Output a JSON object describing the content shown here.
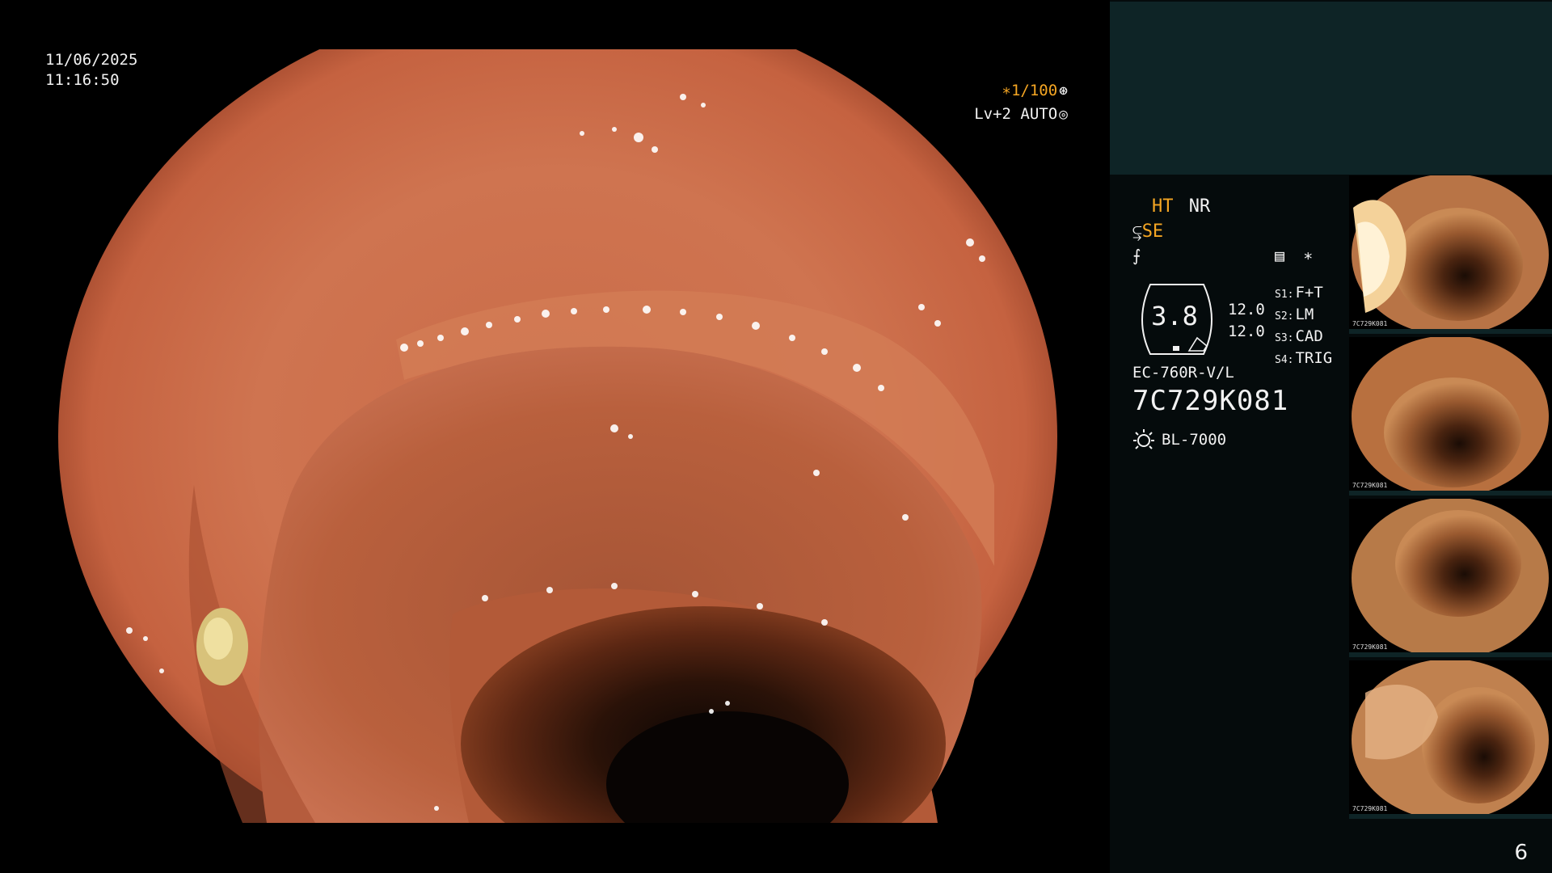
{
  "overlay": {
    "date": "11/06/2025",
    "time": "11:16:50",
    "shutter": "∗1/100",
    "shutter_icon": "⊛",
    "level": "Lv+2 AUTO",
    "level_icon": "◎"
  },
  "panel": {
    "mode_ht": "HT",
    "mode_nr": "NR",
    "mode_se": "SE",
    "se_icon": "⥹",
    "f_icon": "⨍",
    "menu_icon": "▤",
    "star_icon": "∗",
    "hex_value": "3.8",
    "scale": [
      "12.0",
      "12.0"
    ],
    "switches": [
      {
        "key": "S1:",
        "value": "F+T"
      },
      {
        "key": "S2:",
        "value": "LM"
      },
      {
        "key": "S3:",
        "value": "CAD"
      },
      {
        "key": "S4:",
        "value": "TRIG"
      }
    ],
    "scope_model": "EC-760R-V/L",
    "serial_number": "7C729K081",
    "light_source": "BL-7000"
  },
  "thumbnails": [
    {
      "label": "7C729K081"
    },
    {
      "label": "7C729K081"
    },
    {
      "label": "7C729K081"
    },
    {
      "label": "7C729K081"
    }
  ],
  "page_number": "6",
  "colors": {
    "accent_orange": "#f5a623",
    "panel_bg": "#050b0c",
    "panel_top": "#0e2426",
    "tissue": "#c8603f"
  }
}
